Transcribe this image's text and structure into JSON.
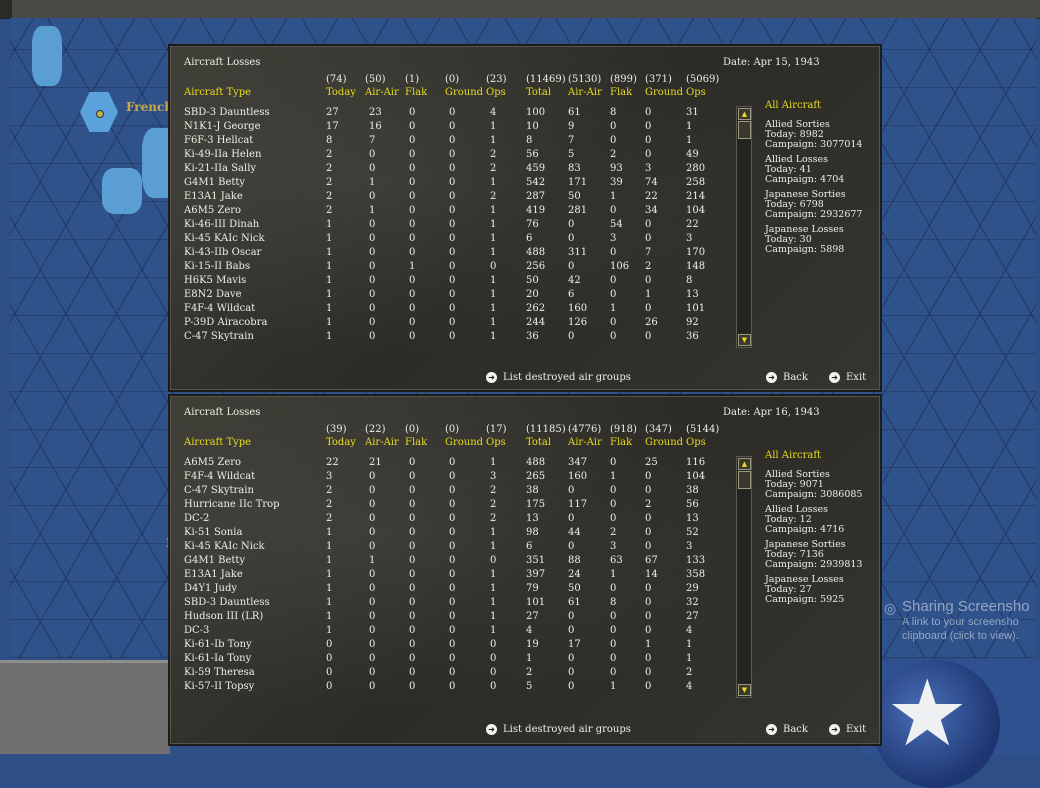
{
  "map": {
    "label_top": "French",
    "label_bottom": "Fr"
  },
  "notification": {
    "title": "Sharing Screensho",
    "text": "A link to your screensho clipboard (click to view)."
  },
  "panels": [
    {
      "title": "Aircraft Losses",
      "date": "Date: Apr 15, 1943",
      "type_header": "Aircraft Type",
      "sums": [
        "(74)",
        "(50)",
        "(1)",
        "(0)",
        "(23)",
        "(11469)",
        "(5130)",
        "(899)",
        "(371)",
        "(5069)"
      ],
      "labels": [
        "Today",
        "Air-Air",
        "Flak",
        "Ground",
        "Ops",
        "Total",
        "Air-Air",
        "Flak",
        "Ground",
        "Ops"
      ],
      "rows": [
        [
          "SBD-3 Dauntless",
          "27",
          "23",
          "0",
          "0",
          "4",
          "100",
          "61",
          "8",
          "0",
          "31"
        ],
        [
          "N1K1-J George",
          "17",
          "16",
          "0",
          "0",
          "1",
          "10",
          "9",
          "0",
          "0",
          "1"
        ],
        [
          "F6F-3 Hellcat",
          "8",
          "7",
          "0",
          "0",
          "1",
          "8",
          "7",
          "0",
          "0",
          "1"
        ],
        [
          "Ki-49-IIa Helen",
          "2",
          "0",
          "0",
          "0",
          "2",
          "56",
          "5",
          "2",
          "0",
          "49"
        ],
        [
          "Ki-21-IIa Sally",
          "2",
          "0",
          "0",
          "0",
          "2",
          "459",
          "83",
          "93",
          "3",
          "280"
        ],
        [
          "G4M1 Betty",
          "2",
          "1",
          "0",
          "0",
          "1",
          "542",
          "171",
          "39",
          "74",
          "258"
        ],
        [
          "E13A1 Jake",
          "2",
          "0",
          "0",
          "0",
          "2",
          "287",
          "50",
          "1",
          "22",
          "214"
        ],
        [
          "A6M5 Zero",
          "2",
          "1",
          "0",
          "0",
          "1",
          "419",
          "281",
          "0",
          "34",
          "104"
        ],
        [
          "Ki-46-III Dinah",
          "1",
          "0",
          "0",
          "0",
          "1",
          "76",
          "0",
          "54",
          "0",
          "22"
        ],
        [
          "Ki-45 KAIc Nick",
          "1",
          "0",
          "0",
          "0",
          "1",
          "6",
          "0",
          "3",
          "0",
          "3"
        ],
        [
          "Ki-43-IIb Oscar",
          "1",
          "0",
          "0",
          "0",
          "1",
          "488",
          "311",
          "0",
          "7",
          "170"
        ],
        [
          "Ki-15-II Babs",
          "1",
          "0",
          "1",
          "0",
          "0",
          "256",
          "0",
          "106",
          "2",
          "148"
        ],
        [
          "H6K5 Mavis",
          "1",
          "0",
          "0",
          "0",
          "1",
          "50",
          "42",
          "0",
          "0",
          "8"
        ],
        [
          "E8N2 Dave",
          "1",
          "0",
          "0",
          "0",
          "1",
          "20",
          "6",
          "0",
          "1",
          "13"
        ],
        [
          "F4F-4 Wildcat",
          "1",
          "0",
          "0",
          "0",
          "1",
          "262",
          "160",
          "1",
          "0",
          "101"
        ],
        [
          "P-39D Airacobra",
          "1",
          "0",
          "0",
          "0",
          "1",
          "244",
          "126",
          "0",
          "26",
          "92"
        ],
        [
          "C-47 Skytrain",
          "1",
          "0",
          "0",
          "0",
          "1",
          "36",
          "0",
          "0",
          "0",
          "36"
        ]
      ],
      "side_header": "All Aircraft",
      "side": [
        {
          "title": "Allied Sorties",
          "today": "Today:   8982",
          "campaign": "Campaign: 3077014"
        },
        {
          "title": "Allied Losses",
          "today": "Today:   41",
          "campaign": "Campaign: 4704"
        },
        {
          "title": "Japanese Sorties",
          "today": "Today:   6798",
          "campaign": "Campaign: 2932677"
        },
        {
          "title": "Japanese Losses",
          "today": "Today:   30",
          "campaign": "Campaign: 5898"
        }
      ],
      "list_link": "List destroyed air groups",
      "back": "Back",
      "exit": "Exit"
    },
    {
      "title": "Aircraft Losses",
      "date": "Date: Apr 16, 1943",
      "type_header": "Aircraft Type",
      "sums": [
        "(39)",
        "(22)",
        "(0)",
        "(0)",
        "(17)",
        "(11185)",
        "(4776)",
        "(918)",
        "(347)",
        "(5144)"
      ],
      "labels": [
        "Today",
        "Air-Air",
        "Flak",
        "Ground",
        "Ops",
        "Total",
        "Air-Air",
        "Flak",
        "Ground",
        "Ops"
      ],
      "rows": [
        [
          "A6M5 Zero",
          "22",
          "21",
          "0",
          "0",
          "1",
          "488",
          "347",
          "0",
          "25",
          "116"
        ],
        [
          "F4F-4 Wildcat",
          "3",
          "0",
          "0",
          "0",
          "3",
          "265",
          "160",
          "1",
          "0",
          "104"
        ],
        [
          "C-47 Skytrain",
          "2",
          "0",
          "0",
          "0",
          "2",
          "38",
          "0",
          "0",
          "0",
          "38"
        ],
        [
          "Hurricane IIc Trop",
          "2",
          "0",
          "0",
          "0",
          "2",
          "175",
          "117",
          "0",
          "2",
          "56"
        ],
        [
          "DC-2",
          "2",
          "0",
          "0",
          "0",
          "2",
          "13",
          "0",
          "0",
          "0",
          "13"
        ],
        [
          "Ki-51 Sonia",
          "1",
          "0",
          "0",
          "0",
          "1",
          "98",
          "44",
          "2",
          "0",
          "52"
        ],
        [
          "Ki-45 KAIc Nick",
          "1",
          "0",
          "0",
          "0",
          "1",
          "6",
          "0",
          "3",
          "0",
          "3"
        ],
        [
          "G4M1 Betty",
          "1",
          "1",
          "0",
          "0",
          "0",
          "351",
          "88",
          "63",
          "67",
          "133"
        ],
        [
          "E13A1 Jake",
          "1",
          "0",
          "0",
          "0",
          "1",
          "397",
          "24",
          "1",
          "14",
          "358"
        ],
        [
          "D4Y1 Judy",
          "1",
          "0",
          "0",
          "0",
          "1",
          "79",
          "50",
          "0",
          "0",
          "29"
        ],
        [
          "SBD-3 Dauntless",
          "1",
          "0",
          "0",
          "0",
          "1",
          "101",
          "61",
          "8",
          "0",
          "32"
        ],
        [
          "Hudson III (LR)",
          "1",
          "0",
          "0",
          "0",
          "1",
          "27",
          "0",
          "0",
          "0",
          "27"
        ],
        [
          "DC-3",
          "1",
          "0",
          "0",
          "0",
          "1",
          "4",
          "0",
          "0",
          "0",
          "4"
        ],
        [
          "Ki-61-Ib Tony",
          "0",
          "0",
          "0",
          "0",
          "0",
          "19",
          "17",
          "0",
          "1",
          "1"
        ],
        [
          "Ki-61-Ia Tony",
          "0",
          "0",
          "0",
          "0",
          "0",
          "1",
          "0",
          "0",
          "0",
          "1"
        ],
        [
          "Ki-59 Theresa",
          "0",
          "0",
          "0",
          "0",
          "0",
          "2",
          "0",
          "0",
          "0",
          "2"
        ],
        [
          "Ki-57-II Topsy",
          "0",
          "0",
          "0",
          "0",
          "0",
          "5",
          "0",
          "1",
          "0",
          "4"
        ]
      ],
      "side_header": "All Aircraft",
      "side": [
        {
          "title": "Allied Sorties",
          "today": "Today:   9071",
          "campaign": "Campaign: 3086085"
        },
        {
          "title": "Allied Losses",
          "today": "Today:   12",
          "campaign": "Campaign: 4716"
        },
        {
          "title": "Japanese Sorties",
          "today": "Today:   7136",
          "campaign": "Campaign: 2939813"
        },
        {
          "title": "Japanese Losses",
          "today": "Today:   27",
          "campaign": "Campaign: 5925"
        }
      ],
      "list_link": "List destroyed air groups",
      "back": "Back",
      "exit": "Exit"
    }
  ]
}
